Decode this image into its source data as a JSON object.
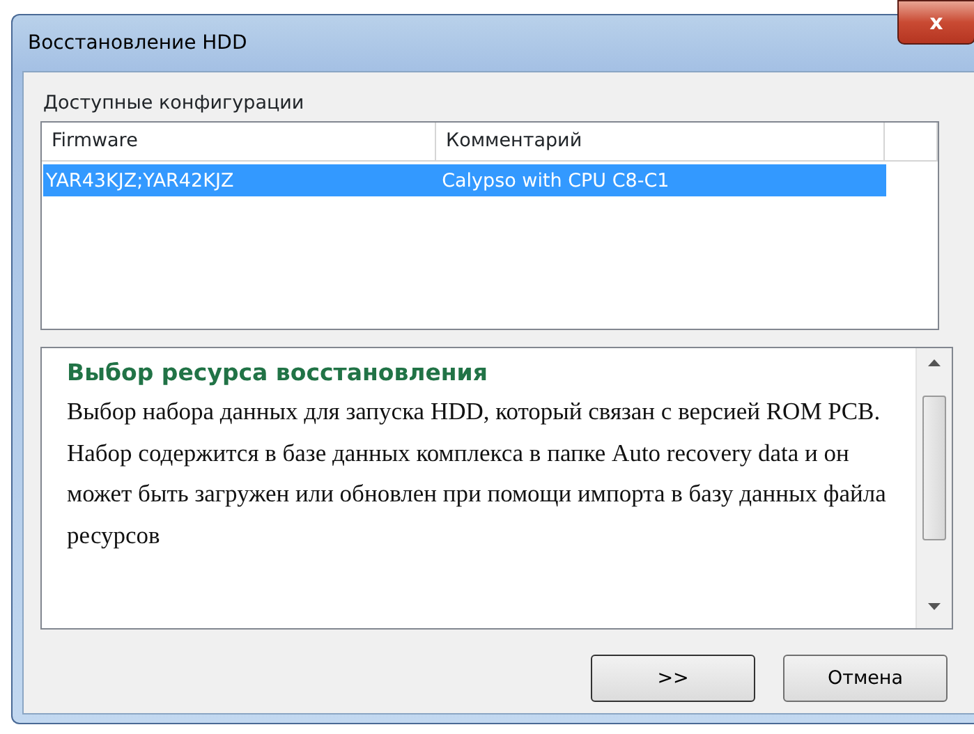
{
  "window": {
    "title": "Восстановление HDD",
    "close": "x"
  },
  "group": {
    "label": "Доступные конфигурации"
  },
  "table": {
    "columns": [
      "Firmware",
      "Комментарий"
    ],
    "rows": [
      {
        "cells": [
          "YAR43KJZ;YAR42KJZ",
          "Calypso with CPU C8-C1"
        ],
        "selected": true
      }
    ]
  },
  "help": {
    "title": "Выбор ресурса восстановления",
    "text": "Выбор набора данных для запуска HDD, который связан с версией ROM PCB. Набор содержится в базе данных комплекса в папке Auto recovery data и он может быть загружен или обновлен при помощи импорта в базу данных файла ресурсов"
  },
  "buttons": [
    ">>",
    "Отмена"
  ]
}
